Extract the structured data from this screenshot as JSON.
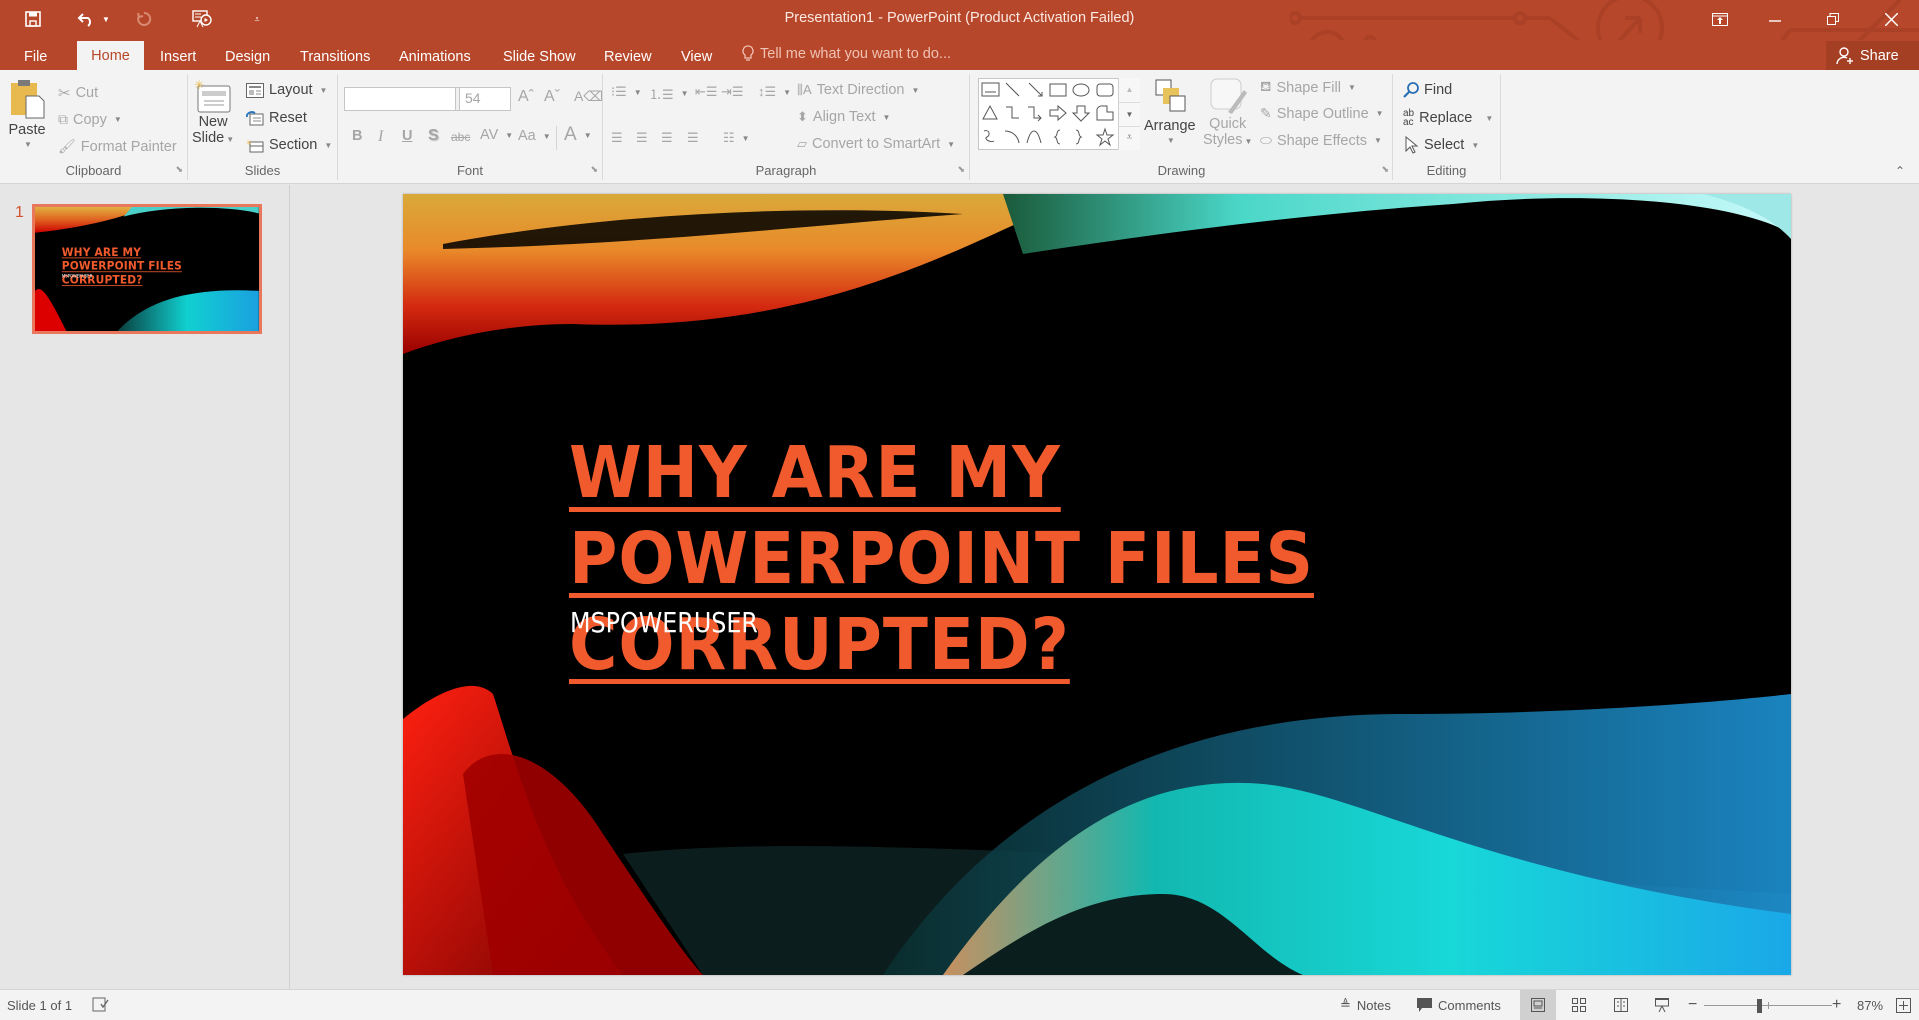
{
  "window": {
    "title": "Presentation1 - PowerPoint (Product Activation Failed)",
    "accent_color": "#b7472a",
    "controls": [
      "ribbon-display-options",
      "minimize",
      "restore",
      "close"
    ]
  },
  "quick_access": [
    "save",
    "undo",
    "redo",
    "start-from-beginning",
    "customize"
  ],
  "tabs": [
    {
      "label": "File"
    },
    {
      "label": "Home",
      "active": true
    },
    {
      "label": "Insert"
    },
    {
      "label": "Design"
    },
    {
      "label": "Transitions"
    },
    {
      "label": "Animations"
    },
    {
      "label": "Slide Show"
    },
    {
      "label": "Review"
    },
    {
      "label": "View"
    }
  ],
  "tell_me": {
    "placeholder": "Tell me what you want to do..."
  },
  "share": {
    "label": "Share"
  },
  "ribbon": {
    "clipboard": {
      "label": "Clipboard",
      "paste": "Paste",
      "cut": "Cut",
      "copy": "Copy",
      "format_painter": "Format Painter"
    },
    "slides": {
      "label": "Slides",
      "new_slide_line1": "New",
      "new_slide_line2": "Slide",
      "layout": "Layout",
      "reset": "Reset",
      "section": "Section"
    },
    "font": {
      "label": "Font",
      "font_name": "",
      "font_size": "54",
      "bold": "B",
      "italic": "I",
      "underline": "U",
      "shadow": "S",
      "strikethrough": "abc",
      "spacing": "AV",
      "change_case": "Aa",
      "font_color": "A"
    },
    "paragraph": {
      "label": "Paragraph",
      "text_direction": "Text Direction",
      "align_text": "Align Text",
      "convert_smartart": "Convert to SmartArt"
    },
    "drawing": {
      "label": "Drawing",
      "arrange": "Arrange",
      "quick_styles_line1": "Quick",
      "quick_styles_line2": "Styles",
      "shape_fill": "Shape Fill",
      "shape_outline": "Shape Outline",
      "shape_effects": "Shape Effects"
    },
    "editing": {
      "label": "Editing",
      "find": "Find",
      "replace": "Replace",
      "select": "Select"
    }
  },
  "thumbnails": [
    {
      "number": "1",
      "selected": true
    }
  ],
  "slide": {
    "title": "WHY ARE MY POWERPOINT FILES CORRUPTED?",
    "subtitle": "MSPOWERUSER",
    "title_color": "#f05a2d"
  },
  "status": {
    "slide_indicator": "Slide 1 of 1",
    "notes": "Notes",
    "comments": "Comments",
    "zoom": "87%",
    "zoom_fraction": 0.87
  }
}
